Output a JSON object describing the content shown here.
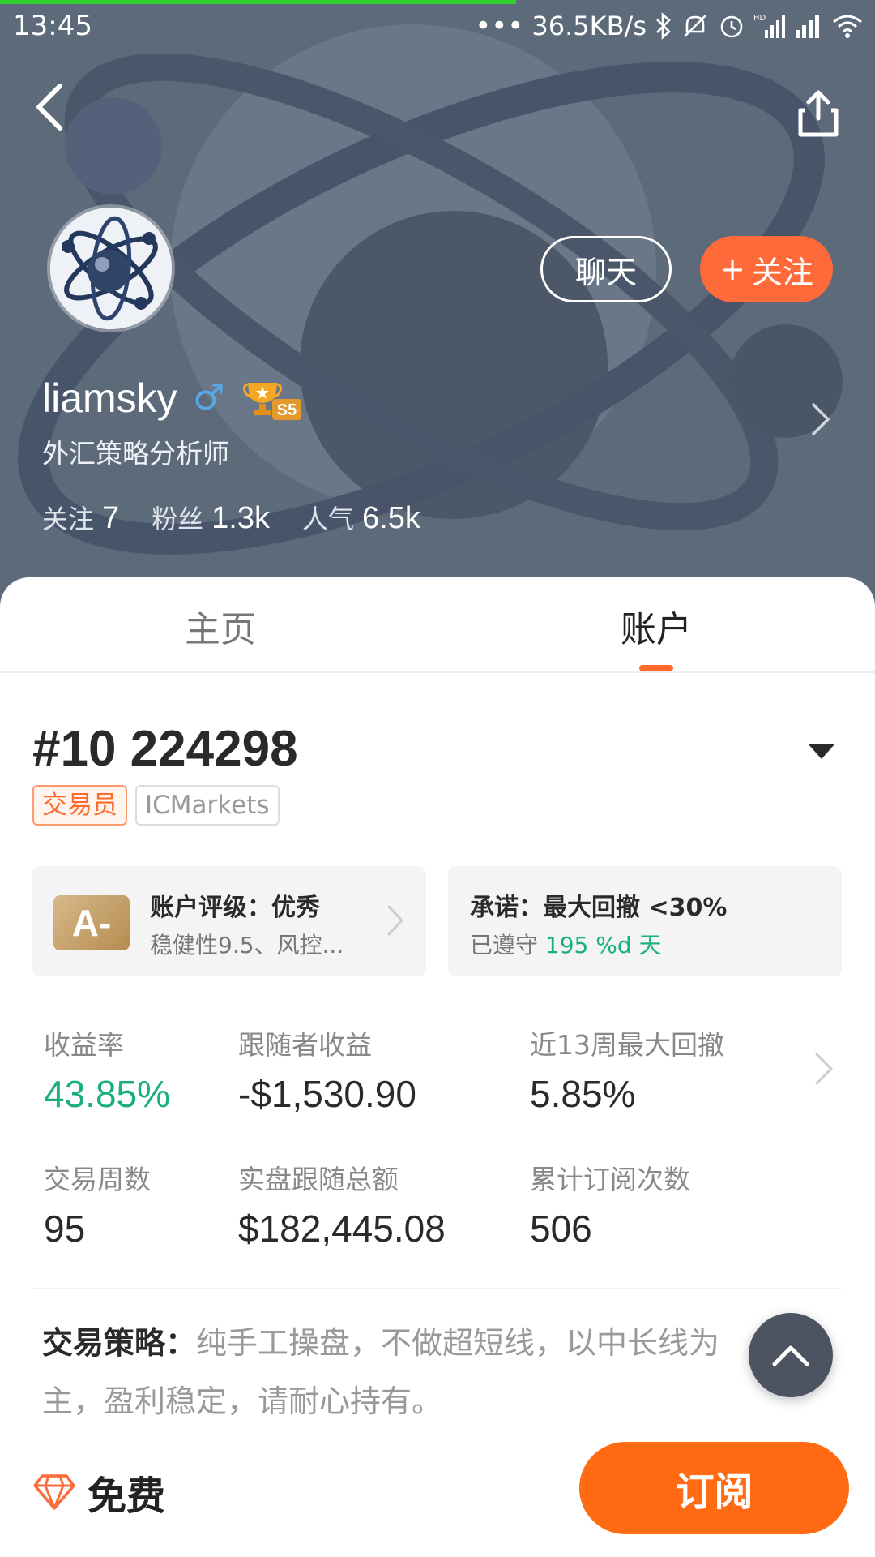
{
  "status_bar": {
    "time": "13:45",
    "network_speed": "36.5KB/s",
    "icons": [
      "dots-icon",
      "bluetooth-icon",
      "mute-icon",
      "alarm-icon",
      "hd-signal-icon",
      "signal-icon",
      "wifi-icon"
    ]
  },
  "header": {
    "back_icon": "chevron-left-icon",
    "share_icon": "share-icon"
  },
  "profile": {
    "username": "liamsky",
    "gender_symbol": "♂",
    "badge_level": "S5",
    "title": "外汇策略分析师",
    "chat_label": "聊天",
    "follow_label": "关注",
    "follow_prefix": "+",
    "stats": [
      {
        "label": "关注",
        "value": "7"
      },
      {
        "label": "粉丝",
        "value": "1.3k"
      },
      {
        "label": "人气",
        "value": "6.5k"
      }
    ]
  },
  "tabs": [
    {
      "label": "主页",
      "active": false
    },
    {
      "label": "账户",
      "active": true
    }
  ],
  "account": {
    "title": "#10 224298",
    "tag_role": "交易员",
    "tag_broker": "ICMarkets",
    "rating_card": {
      "grade": "A-",
      "title": "账户评级：优秀",
      "subtitle": "稳健性9.5、风控..."
    },
    "promise_card": {
      "title": "承诺：最大回撤 <30%",
      "subtitle_prefix": "已遵守",
      "subtitle_value": "195 %d 天"
    },
    "metrics": [
      {
        "label": "收益率",
        "value": "43.85%"
      },
      {
        "label": "跟随者收益",
        "value": "-$1,530.90"
      },
      {
        "label": "近13周最大回撤",
        "value": "5.85%"
      },
      {
        "label": "交易周数",
        "value": "95"
      },
      {
        "label": "实盘跟随总额",
        "value": "$182,445.08"
      },
      {
        "label": "累计订阅次数",
        "value": "506"
      }
    ],
    "strategy_label": "交易策略：",
    "strategy_text": "纯手工操盘，不做超短线，以中长线为主，盈利稳定，请耐心持有。"
  },
  "bottom_bar": {
    "price_label": "免费",
    "subscribe_label": "订阅"
  },
  "colors": {
    "accent_orange": "#ff6a12",
    "follow_orange": "#ff6a3a",
    "positive_green": "#19b07a",
    "hero_bg": "#5b6878"
  }
}
